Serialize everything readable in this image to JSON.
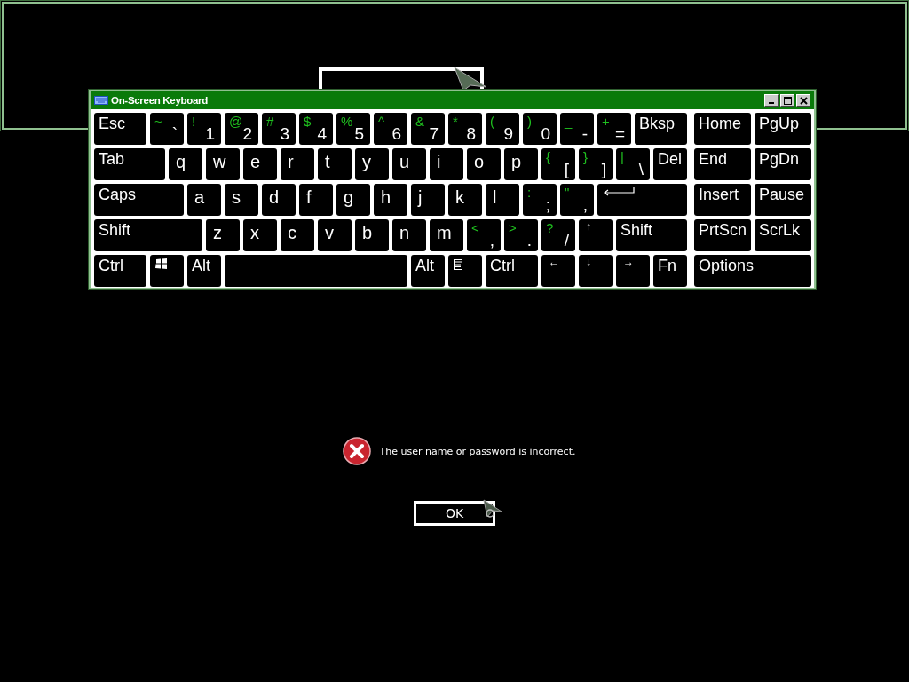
{
  "keyboard": {
    "title": "On-Screen Keyboard",
    "rows": [
      {
        "keys": [
          {
            "kind": "label",
            "label": "Esc"
          },
          {
            "kind": "symbol",
            "shift": "~",
            "label": "`"
          },
          {
            "kind": "symbol",
            "shift": "!",
            "label": "1"
          },
          {
            "kind": "symbol",
            "shift": "@",
            "label": "2"
          },
          {
            "kind": "symbol",
            "shift": "#",
            "label": "3"
          },
          {
            "kind": "symbol",
            "shift": "$",
            "label": "4"
          },
          {
            "kind": "symbol",
            "shift": "%",
            "label": "5"
          },
          {
            "kind": "symbol",
            "shift": "^",
            "label": "6"
          },
          {
            "kind": "symbol",
            "shift": "&",
            "label": "7"
          },
          {
            "kind": "symbol",
            "shift": "*",
            "label": "8"
          },
          {
            "kind": "symbol",
            "shift": "(",
            "label": "9"
          },
          {
            "kind": "symbol",
            "shift": ")",
            "label": "0"
          },
          {
            "kind": "symbol",
            "shift": "_",
            "label": "-"
          },
          {
            "kind": "symbol",
            "shift": "+",
            "label": "="
          },
          {
            "kind": "label",
            "label": "Bksp"
          }
        ]
      },
      {
        "keys": [
          {
            "kind": "label",
            "label": "Tab"
          },
          {
            "kind": "letter",
            "label": "q"
          },
          {
            "kind": "letter",
            "label": "w"
          },
          {
            "kind": "letter",
            "label": "e"
          },
          {
            "kind": "letter",
            "label": "r"
          },
          {
            "kind": "letter",
            "label": "t"
          },
          {
            "kind": "letter",
            "label": "y"
          },
          {
            "kind": "letter",
            "label": "u"
          },
          {
            "kind": "letter",
            "label": "i"
          },
          {
            "kind": "letter",
            "label": "o"
          },
          {
            "kind": "letter",
            "label": "p"
          },
          {
            "kind": "symbol",
            "shift": "{",
            "label": "["
          },
          {
            "kind": "symbol",
            "shift": "}",
            "label": "]"
          },
          {
            "kind": "symbol",
            "shift": "|",
            "label": "\\"
          },
          {
            "kind": "label",
            "label": "Del"
          }
        ]
      },
      {
        "keys": [
          {
            "kind": "label",
            "label": "Caps"
          },
          {
            "kind": "letter",
            "label": "a"
          },
          {
            "kind": "letter",
            "label": "s"
          },
          {
            "kind": "letter",
            "label": "d"
          },
          {
            "kind": "letter",
            "label": "f"
          },
          {
            "kind": "letter",
            "label": "g"
          },
          {
            "kind": "letter",
            "label": "h"
          },
          {
            "kind": "letter",
            "label": "j"
          },
          {
            "kind": "letter",
            "label": "k"
          },
          {
            "kind": "letter",
            "label": "l"
          },
          {
            "kind": "symbol",
            "shift": ":",
            "label": ";"
          },
          {
            "kind": "symbol",
            "shift": "\"",
            "label": ","
          },
          {
            "kind": "enter"
          }
        ]
      },
      {
        "keys": [
          {
            "kind": "label",
            "label": "Shift"
          },
          {
            "kind": "letter",
            "label": "z"
          },
          {
            "kind": "letter",
            "label": "x"
          },
          {
            "kind": "letter",
            "label": "c"
          },
          {
            "kind": "letter",
            "label": "v"
          },
          {
            "kind": "letter",
            "label": "b"
          },
          {
            "kind": "letter",
            "label": "n"
          },
          {
            "kind": "letter",
            "label": "m"
          },
          {
            "kind": "symbol",
            "shift": "<",
            "label": ","
          },
          {
            "kind": "symbol",
            "shift": ">",
            "label": "."
          },
          {
            "kind": "symbol",
            "shift": "?",
            "label": "/"
          },
          {
            "kind": "arrow",
            "label": "↑"
          },
          {
            "kind": "label",
            "label": "Shift"
          }
        ]
      },
      {
        "keys": [
          {
            "kind": "label",
            "label": "Ctrl"
          },
          {
            "kind": "windows"
          },
          {
            "kind": "label",
            "label": "Alt"
          },
          {
            "kind": "space"
          },
          {
            "kind": "label",
            "label": "Alt"
          },
          {
            "kind": "menu"
          },
          {
            "kind": "label",
            "label": "Ctrl"
          },
          {
            "kind": "arrow",
            "label": "←"
          },
          {
            "kind": "arrow",
            "label": "↓"
          },
          {
            "kind": "arrow",
            "label": "→"
          },
          {
            "kind": "label",
            "label": "Fn"
          }
        ]
      }
    ],
    "nav_rows": [
      {
        "keys": [
          {
            "kind": "label",
            "label": "Home"
          },
          {
            "kind": "label",
            "label": "PgUp"
          }
        ]
      },
      {
        "keys": [
          {
            "kind": "label",
            "label": "End"
          },
          {
            "kind": "label",
            "label": "PgDn"
          }
        ]
      },
      {
        "keys": [
          {
            "kind": "label",
            "label": "Insert"
          },
          {
            "kind": "label",
            "label": "Pause"
          }
        ]
      },
      {
        "keys": [
          {
            "kind": "label",
            "label": "PrtScn"
          },
          {
            "kind": "label",
            "label": "ScrLk"
          }
        ]
      },
      {
        "keys": [
          {
            "kind": "label",
            "label": "Options"
          }
        ]
      }
    ]
  },
  "error": {
    "message": "The user name or password is incorrect.",
    "button": "OK"
  }
}
